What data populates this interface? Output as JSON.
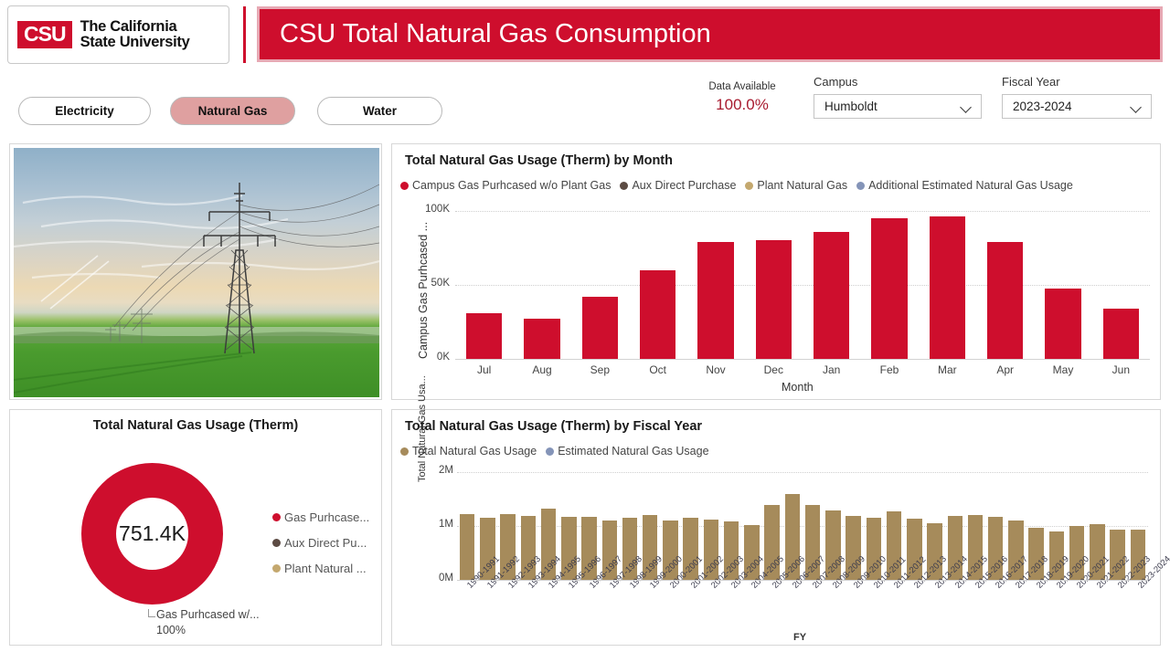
{
  "header": {
    "logo_mark": "CSU",
    "logo_line1": "The California",
    "logo_line2": "State University",
    "title": "CSU Total Natural Gas Consumption",
    "brand_red": "#CE0E2D",
    "title_border": "#E7A9B4"
  },
  "toolbar": {
    "tabs": [
      {
        "label": "Electricity",
        "active": false
      },
      {
        "label": "Natural Gas",
        "active": true
      },
      {
        "label": "Water",
        "active": false
      }
    ],
    "active_tab_color": "#DFA0A0",
    "kpi": {
      "label": "Data Available",
      "value": "100.0%",
      "color": "#A81B2F"
    },
    "campus": {
      "label": "Campus",
      "value": "Humboldt"
    },
    "fiscal_year": {
      "label": "Fiscal Year",
      "value": "2023-2024"
    }
  },
  "photo": {
    "alt": "Electric transmission tower in a green field at sunset"
  },
  "donut_card": {
    "title": "Total Natural Gas Usage (Therm)",
    "center_value": "751.4K",
    "callout_label": "Gas Purhcased w/...",
    "callout_percent": "100%",
    "legend": [
      {
        "label": "Gas Purhcase...",
        "color": "#CE0E2D"
      },
      {
        "label": "Aux Direct Pu...",
        "color": "#5C4B43"
      },
      {
        "label": "Plant Natural ...",
        "color": "#C4A86E"
      }
    ]
  },
  "chart_data": [
    {
      "type": "bar",
      "id": "monthly",
      "title": "Total Natural Gas Usage (Therm) by Month",
      "xlabel": "Month",
      "ylabel": "Campus Gas Purhcased ...",
      "ylim": [
        0,
        100000
      ],
      "yticks": [
        0,
        50000,
        100000
      ],
      "ytick_labels": [
        "0K",
        "50K",
        "100K"
      ],
      "grid": true,
      "legend_position": "top",
      "legend": [
        {
          "label": "Campus Gas Purhcased w/o Plant Gas",
          "color": "#CE0E2D"
        },
        {
          "label": "Aux Direct Purchase",
          "color": "#5C4B43"
        },
        {
          "label": "Plant Natural Gas",
          "color": "#C4A86E"
        },
        {
          "label": "Additional Estimated Natural Gas Usage",
          "color": "#8494B8"
        }
      ],
      "categories": [
        "Jul",
        "Aug",
        "Sep",
        "Oct",
        "Nov",
        "Dec",
        "Jan",
        "Feb",
        "Mar",
        "Apr",
        "May",
        "Jun"
      ],
      "values": [
        31000,
        27000,
        42000,
        60000,
        79000,
        80500,
        86000,
        95000,
        96000,
        79000,
        47500,
        34000
      ],
      "bar_color": "#CE0E2D"
    },
    {
      "type": "bar",
      "id": "fiscal_year",
      "title": "Total Natural Gas Usage (Therm) by Fiscal Year",
      "xlabel": "FY",
      "ylabel": "Total Natural Gas Usa...",
      "ylim": [
        0,
        2000000
      ],
      "yticks": [
        0,
        1000000,
        2000000
      ],
      "ytick_labels": [
        "0M",
        "1M",
        "2M"
      ],
      "grid": true,
      "legend_position": "top",
      "legend": [
        {
          "label": "Total Natural Gas Usage",
          "color": "#A68B5B"
        },
        {
          "label": "Estimated Natural Gas Usage",
          "color": "#8494B8"
        }
      ],
      "categories": [
        "1990-1991",
        "1991-1992",
        "1992-1993",
        "1993-1994",
        "1994-1995",
        "1995-1996",
        "1996-1997",
        "1997-1998",
        "1998-1999",
        "1999-2000",
        "2000-2001",
        "2001-2002",
        "2002-2003",
        "2003-2004",
        "2004-2005",
        "2005-2006",
        "2006-2007",
        "2007-2008",
        "2008-2009",
        "2009-2010",
        "2010-2011",
        "2011-2012",
        "2012-2013",
        "2013-2014",
        "2014-2015",
        "2015-2016",
        "2016-2017",
        "2017-2018",
        "2018-2019",
        "2019-2020",
        "2020-2021",
        "2021-2022",
        "2022-2023",
        "2023-2024"
      ],
      "values": [
        1215000,
        1160000,
        1215000,
        1195000,
        1315000,
        1175000,
        1175000,
        1110000,
        1150000,
        1210000,
        1105000,
        1155000,
        1115000,
        1080000,
        1010000,
        1395000,
        1595000,
        1390000,
        1280000,
        1185000,
        1155000,
        1265000,
        1130000,
        1055000,
        1185000,
        1210000,
        1175000,
        1110000,
        960000,
        895000,
        1000000,
        1040000,
        930000,
        930000
      ],
      "bar_color": "#A68B5B"
    }
  ]
}
